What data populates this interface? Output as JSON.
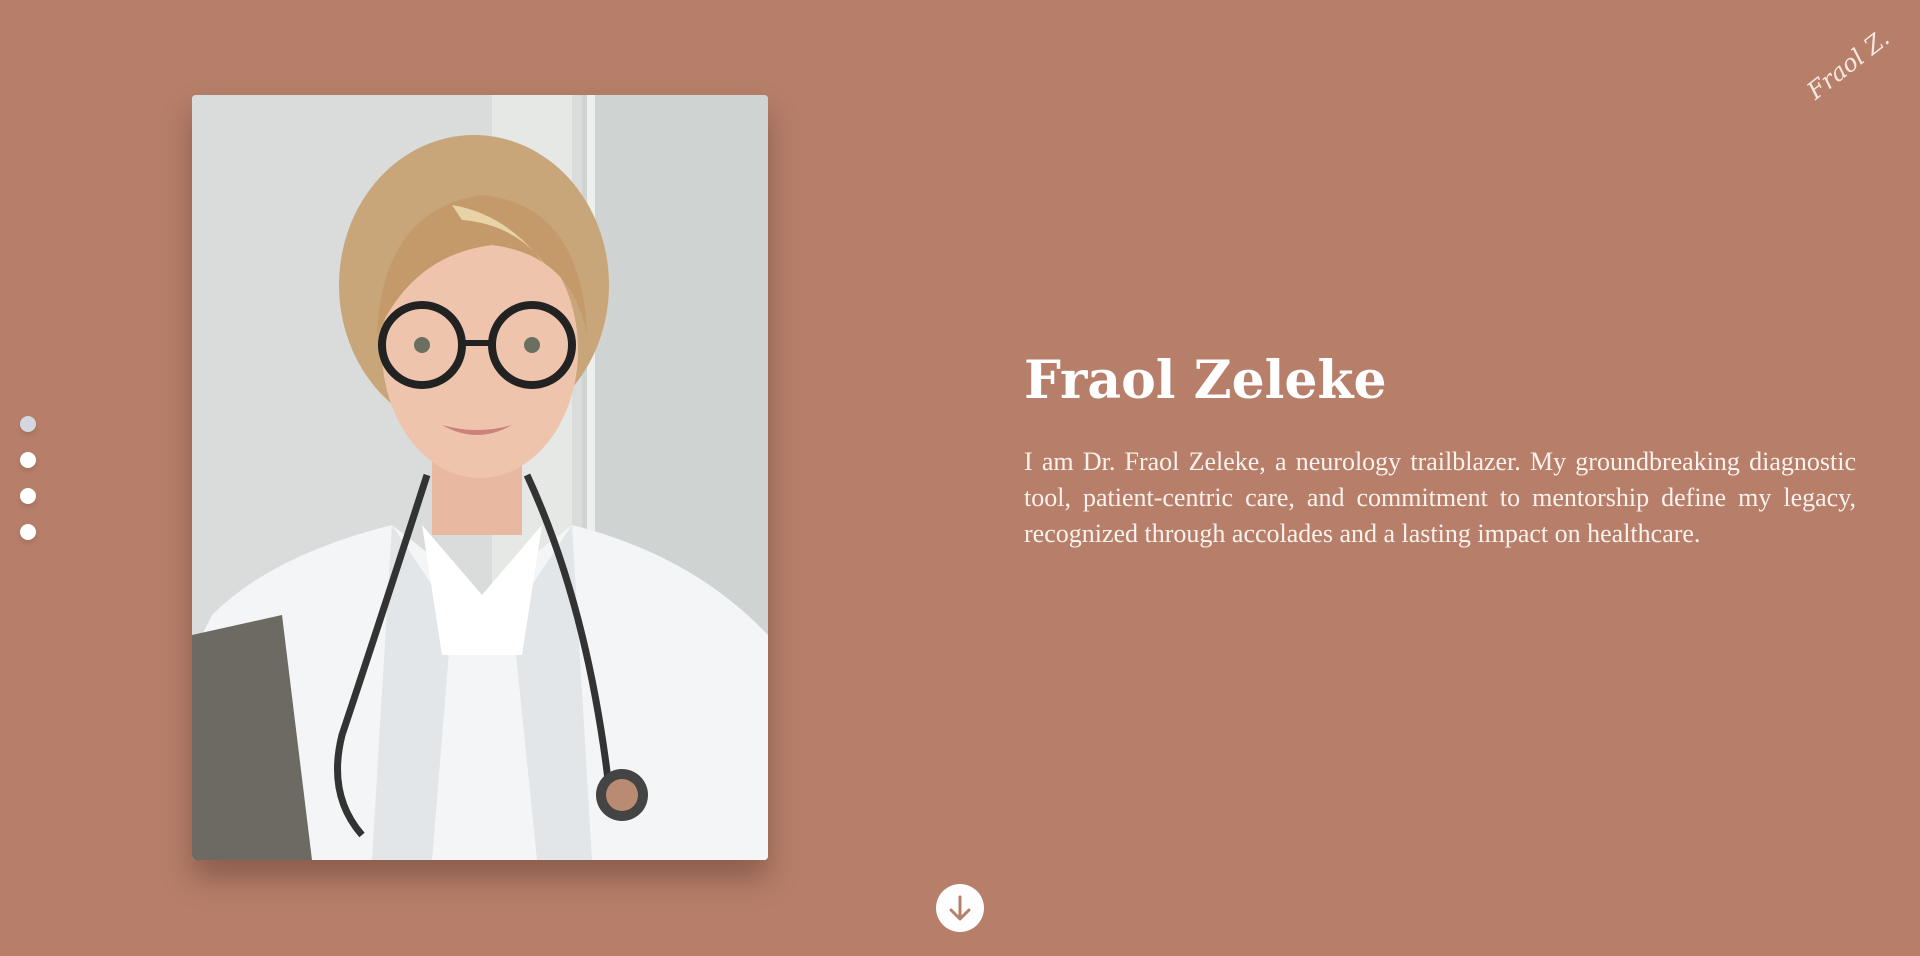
{
  "signature": {
    "text": "Fraol Z.",
    "color": "#f6e9e4"
  },
  "nav": {
    "dots": [
      {
        "label": "slide-1",
        "active": true
      },
      {
        "label": "slide-2",
        "active": false
      },
      {
        "label": "slide-3",
        "active": false
      },
      {
        "label": "slide-4",
        "active": false
      }
    ]
  },
  "hero": {
    "name": "Fraol Zeleke",
    "bio": "I am Dr. Fraol Zeleke, a neurology trailblazer. My groundbreaking diagnostic tool, patient-centric care, and commitment to mentorship define my legacy, recognized through accolades and a lasting impact on healthcare.",
    "photo_icon": "doctor-portrait-photo"
  },
  "scroll": {
    "icon": "arrow-down-icon"
  },
  "colors": {
    "background": "#b77f6a",
    "text": "#ffffff",
    "accent": "#b77f6a"
  }
}
